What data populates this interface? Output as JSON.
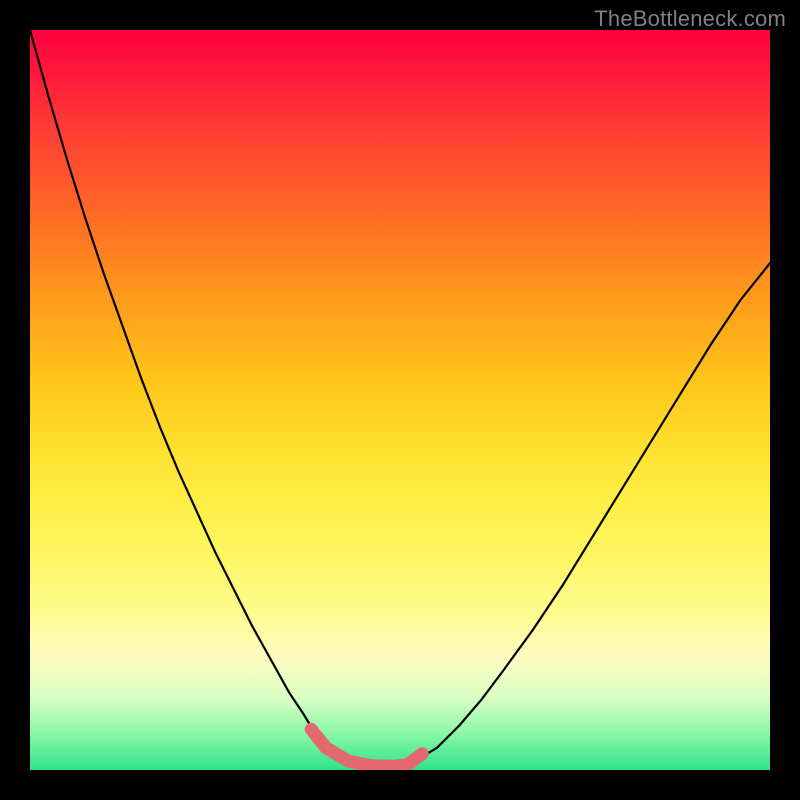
{
  "watermark": "TheBottleneck.com",
  "colors": {
    "bg_black": "#000000",
    "curve_black": "#000000",
    "highlight_pink": "#e4696e",
    "watermark_gray": "#808080"
  },
  "chart_data": {
    "type": "line",
    "title": "",
    "xlabel": "",
    "ylabel": "",
    "xlim": [
      0,
      100
    ],
    "ylim": [
      0,
      100
    ],
    "grid": false,
    "legend": false,
    "description": "V-shaped bottleneck curve with flat minimum, rendered over a vertical red→green gradient. Values are estimated from pixel positions (no axis labels present).",
    "series": [
      {
        "name": "bottleneck-curve",
        "x": [
          0,
          2.5,
          5,
          7.5,
          10,
          12.5,
          15,
          17.5,
          20,
          22.5,
          25,
          27.5,
          30,
          32.5,
          35,
          37,
          38.5,
          40,
          43,
          46,
          49,
          51,
          52,
          55,
          58,
          61,
          64,
          68,
          72,
          76,
          80,
          84,
          88,
          92,
          96,
          100
        ],
        "y": [
          100,
          91,
          82.5,
          74.5,
          67,
          60,
          53,
          46.5,
          40.5,
          35,
          29.5,
          24.5,
          19.5,
          15,
          10.5,
          7.5,
          5,
          3,
          1.2,
          0.6,
          0.5,
          0.7,
          1.2,
          3,
          6,
          9.5,
          13.5,
          19,
          25,
          31.5,
          38,
          44.5,
          51,
          57.5,
          63.5,
          68.5
        ]
      },
      {
        "name": "highlight-segment",
        "x": [
          38,
          40,
          43,
          46,
          49,
          51,
          53
        ],
        "y": [
          5.5,
          3,
          1.2,
          0.6,
          0.5,
          0.7,
          2.2
        ]
      }
    ]
  }
}
